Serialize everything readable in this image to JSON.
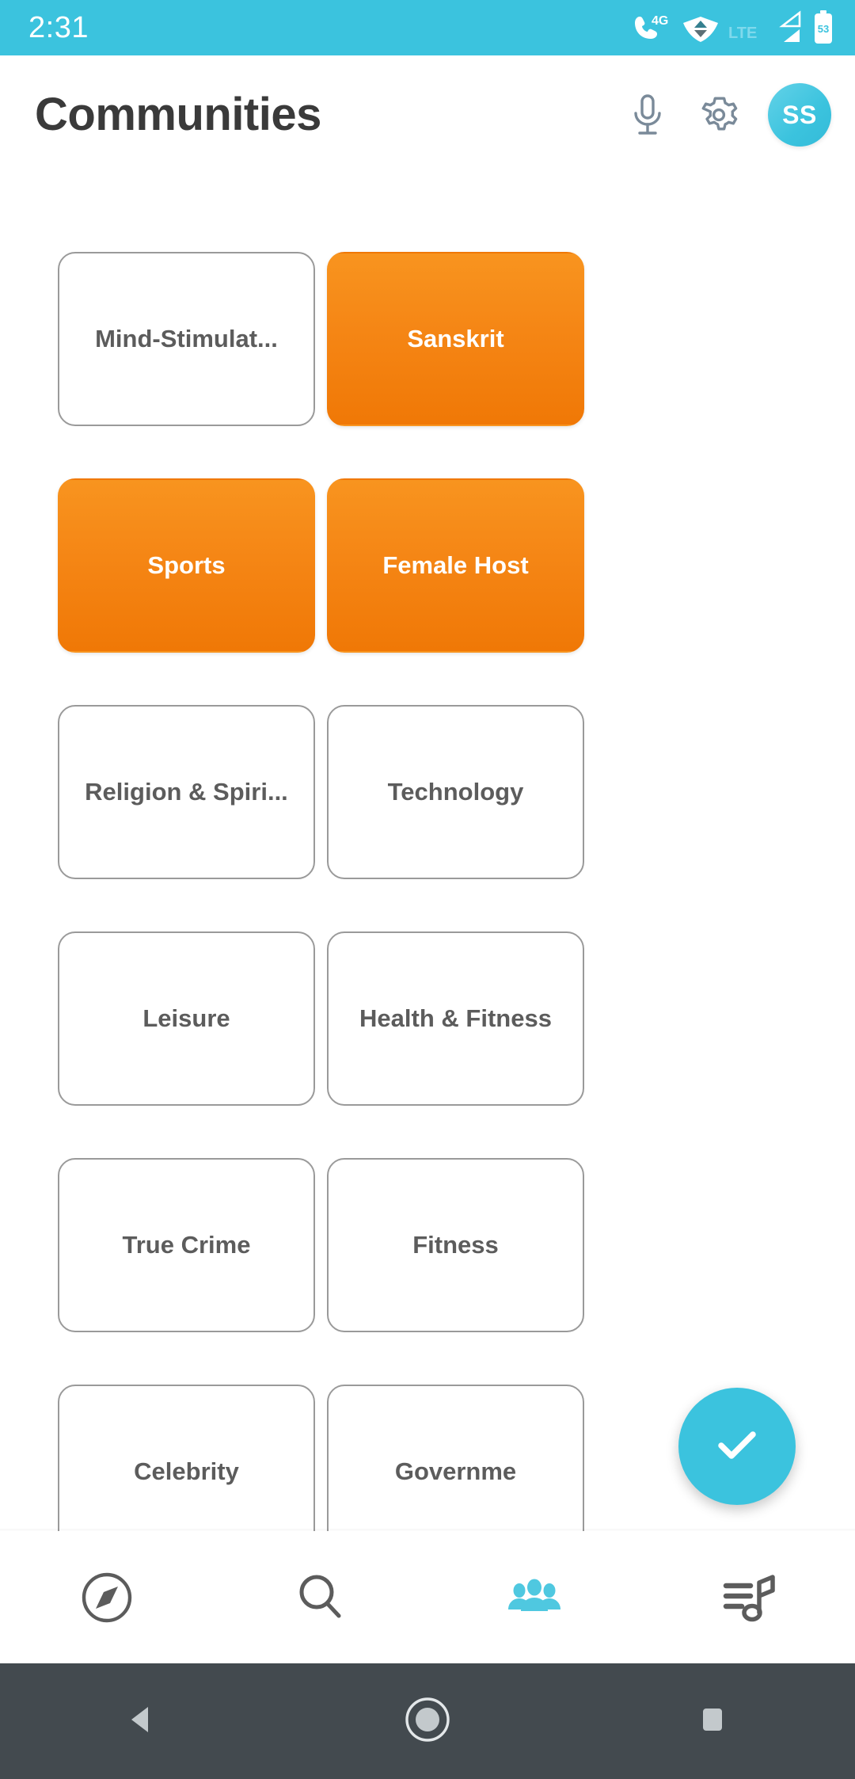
{
  "status_bar": {
    "time": "2:31",
    "network_type": "4G",
    "network_label": "LTE",
    "battery_level": "53",
    "icons": [
      "phone-4g-icon",
      "wifi-icon",
      "lte-label",
      "signal-bars-icon",
      "battery-icon"
    ]
  },
  "header": {
    "title": "Communities",
    "mic_icon": "microphone-icon",
    "settings_icon": "gear-icon",
    "avatar_initials": "SS"
  },
  "communities": [
    {
      "label": "Mind-Stimulat...",
      "selected": false
    },
    {
      "label": "Sanskrit",
      "selected": true
    },
    {
      "label": "Sports",
      "selected": true
    },
    {
      "label": "Female Host",
      "selected": true
    },
    {
      "label": "Religion & Spiri...",
      "selected": false
    },
    {
      "label": "Technology",
      "selected": false
    },
    {
      "label": "Leisure",
      "selected": false
    },
    {
      "label": "Health & Fitness",
      "selected": false
    },
    {
      "label": "True Crime",
      "selected": false
    },
    {
      "label": "Fitness",
      "selected": false
    },
    {
      "label": "Celebrity",
      "selected": false
    },
    {
      "label": "Governme",
      "selected": false
    }
  ],
  "fab": {
    "icon": "check-icon",
    "action_label": "Confirm selection"
  },
  "bottom_nav": [
    {
      "name": "explore",
      "icon": "compass-icon",
      "active": false
    },
    {
      "name": "search",
      "icon": "search-icon",
      "active": false
    },
    {
      "name": "communities",
      "icon": "people-group-icon",
      "active": true
    },
    {
      "name": "playlist",
      "icon": "playlist-music-icon",
      "active": false
    }
  ],
  "android_nav": [
    {
      "name": "back",
      "icon": "triangle-back-icon"
    },
    {
      "name": "home",
      "icon": "circle-home-icon"
    },
    {
      "name": "recents",
      "icon": "square-recents-icon"
    }
  ],
  "colors": {
    "accent_cyan": "#3BC3DE",
    "selected_orange_top": "#F8941F",
    "selected_orange_bottom": "#F07806",
    "chip_border": "#9a9a9a",
    "chip_text": "#5c5c5c",
    "title_text": "#3a3a3a",
    "nav_icon": "#5c5c5c",
    "android_nav_bg": "#434a4f"
  }
}
